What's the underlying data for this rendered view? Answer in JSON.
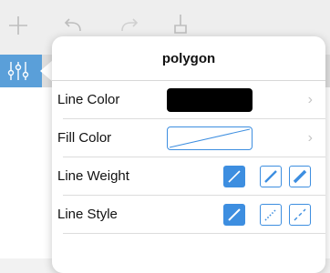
{
  "toolbar": {
    "buttons": [
      "add-icon",
      "undo-icon",
      "redo-icon",
      "tool-icon"
    ]
  },
  "popover": {
    "title": "polygon",
    "rows": [
      {
        "label": "Line Color",
        "swatch": "#000000"
      },
      {
        "label": "Fill Color",
        "swatch": "none"
      },
      {
        "label": "Line Weight",
        "options": [
          "thin",
          "medium",
          "thick"
        ],
        "selected": "thin"
      },
      {
        "label": "Line Style",
        "options": [
          "solid",
          "dotted",
          "dashed"
        ],
        "selected": "solid"
      }
    ]
  },
  "colors": {
    "accent": "#3d8ee0",
    "props_button": "#5a9fd9"
  }
}
